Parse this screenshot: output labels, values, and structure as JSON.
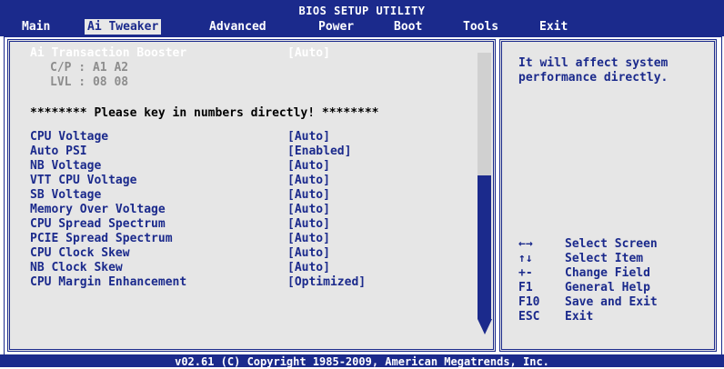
{
  "header": {
    "title": "BIOS SETUP UTILITY",
    "menu": [
      "Main",
      "Ai Tweaker",
      "Advanced",
      "Power",
      "Boot",
      "Tools",
      "Exit"
    ],
    "active_menu": "Ai Tweaker"
  },
  "left_panel": {
    "transaction_boost": {
      "label": "Ai Transaction Booster",
      "value": "[Auto]"
    },
    "cp_line": "C/P : A1 A2",
    "lvl_line": "LVL : 08 08",
    "notice": "******** Please key in numbers directly! ********",
    "settings": [
      {
        "label": "CPU Voltage",
        "value": "[Auto]"
      },
      {
        "label": "Auto PSI",
        "value": "[Enabled]"
      },
      {
        "label": "NB Voltage",
        "value": "[Auto]"
      },
      {
        "label": "VTT CPU Voltage",
        "value": "[Auto]"
      },
      {
        "label": "SB Voltage",
        "value": "[Auto]"
      },
      {
        "label": "Memory Over Voltage",
        "value": "[Auto]"
      },
      {
        "label": "CPU Spread Spectrum",
        "value": "[Auto]"
      },
      {
        "label": "PCIE Spread Spectrum",
        "value": "[Auto]"
      },
      {
        "label": "CPU Clock Skew",
        "value": "[Auto]"
      },
      {
        "label": "NB Clock Skew",
        "value": "[Auto]"
      },
      {
        "label": "CPU Margin Enhancement",
        "value": "[Optimized]"
      }
    ]
  },
  "help_panel": {
    "line1": "It will affect system",
    "line2": "performance directly.",
    "keys": [
      {
        "key": "←→",
        "desc": "Select Screen"
      },
      {
        "key": "↑↓",
        "desc": "Select Item"
      },
      {
        "key": "+-",
        "desc": "Change Field"
      },
      {
        "key": "F1",
        "desc": "General Help"
      },
      {
        "key": "F10",
        "desc": "Save and Exit"
      },
      {
        "key": "ESC",
        "desc": "Exit"
      }
    ]
  },
  "footer": {
    "text": "v02.61 (C) Copyright 1985-2009, American Megatrends, Inc."
  },
  "colors": {
    "primary": "#1b2a8c",
    "panel_bg": "#e6e6e6",
    "disabled_text": "#8d8d8d"
  }
}
